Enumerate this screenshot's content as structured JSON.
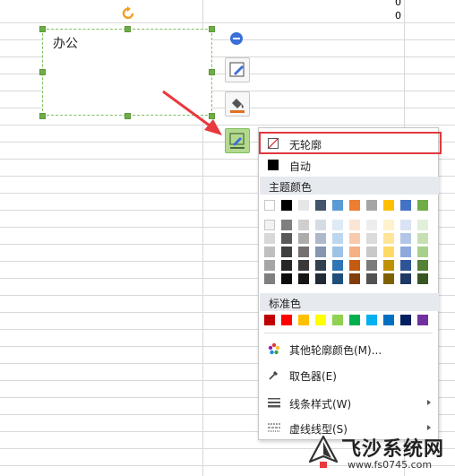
{
  "sheet": {
    "cell_values": [
      "0",
      "0"
    ]
  },
  "textbox": {
    "text": "办公"
  },
  "side_toolbar": {
    "buttons": [
      "edit-shape",
      "fill-color",
      "outline-color"
    ]
  },
  "outline_menu": {
    "no_outline": "无轮廓",
    "auto": "自动",
    "theme_colors_title": "主题颜色",
    "standard_colors_title": "标准色",
    "more_colors": "其他轮廓颜色(M)...",
    "eyedropper": "取色器(E)",
    "line_style": "线条样式(W)",
    "dash_style": "虚线线型(S)",
    "theme_top_row": [
      "#ffffff",
      "#000000",
      "#e7e6e6",
      "#44546a",
      "#5b9bd5",
      "#ed7d31",
      "#a5a5a5",
      "#ffc000",
      "#4472c4",
      "#70ad47"
    ],
    "theme_shades": [
      [
        "#f2f2f2",
        "#7f7f7f",
        "#d0cece",
        "#d6dce4",
        "#deebf6",
        "#fbe5d5",
        "#ededed",
        "#fff2cc",
        "#dae3f3",
        "#e2efd9"
      ],
      [
        "#d8d8d8",
        "#595959",
        "#aeabab",
        "#adb9ca",
        "#bdd7ee",
        "#f7cbac",
        "#dbdbdb",
        "#fee599",
        "#b4c6e7",
        "#c5e0b3"
      ],
      [
        "#bfbfbf",
        "#3f3f3f",
        "#757070",
        "#8496b0",
        "#9dc3e6",
        "#f4b183",
        "#c9c9c9",
        "#ffd965",
        "#8eaadb",
        "#a8d08d"
      ],
      [
        "#a5a5a5",
        "#262626",
        "#3a3838",
        "#323f4f",
        "#2e75b5",
        "#c55a11",
        "#7b7b7b",
        "#bf9000",
        "#2f5496",
        "#538135"
      ],
      [
        "#7f7f7f",
        "#0c0c0c",
        "#171616",
        "#222a35",
        "#1e4e79",
        "#833c0b",
        "#525252",
        "#7f6000",
        "#1f3864",
        "#375623"
      ]
    ],
    "standard_colors": [
      "#c00000",
      "#ff0000",
      "#ffc000",
      "#ffff00",
      "#92d050",
      "#00b050",
      "#00b0f0",
      "#0070c0",
      "#002060",
      "#7030a0"
    ]
  },
  "watermark": {
    "name": "飞沙系统网",
    "url": "www.fs0745.com"
  },
  "colors": {
    "highlight_border": "#e0393e",
    "arrow": "#e8393e",
    "selection_green": "#70ad47"
  }
}
